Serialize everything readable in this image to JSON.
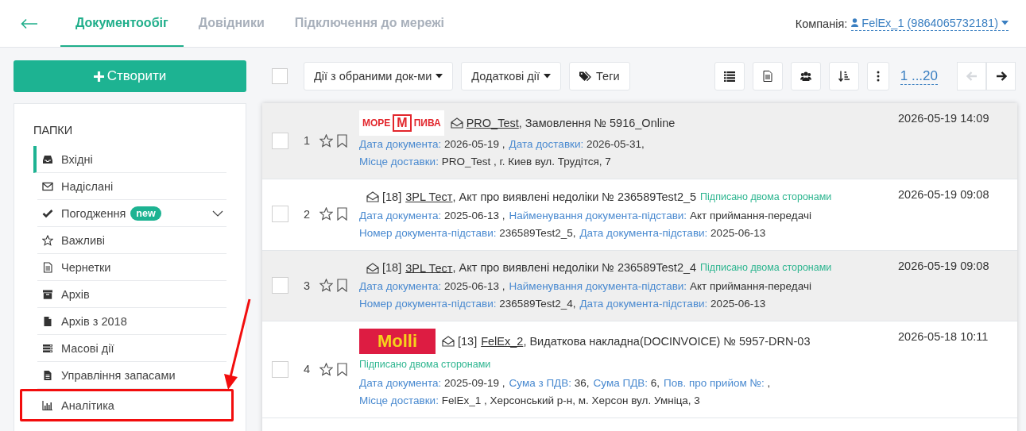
{
  "header": {
    "tabs": [
      {
        "label": "Документообіг",
        "selected": true
      },
      {
        "label": "Довідники",
        "selected": false
      },
      {
        "label": "Підключення до мережі",
        "selected": false
      }
    ],
    "company_label": "Компанія:",
    "company": "FelEx_1 (9864065732181)"
  },
  "create_button": "Створити",
  "sidebar": {
    "title": "ПАПКИ",
    "items": [
      {
        "label": "Вхідні",
        "selected": true,
        "highlighted": false
      },
      {
        "label": "Надіслані",
        "selected": false,
        "highlighted": false
      },
      {
        "label": "Погодження",
        "badge": "new",
        "expanded": false,
        "selected": false,
        "highlighted": false
      },
      {
        "label": "Важливі",
        "selected": false,
        "highlighted": false
      },
      {
        "label": "Чернетки",
        "selected": false,
        "highlighted": false
      },
      {
        "label": "Архів",
        "selected": false,
        "highlighted": false
      },
      {
        "label": "Архів з 2018",
        "selected": false,
        "highlighted": false
      },
      {
        "label": "Масові дії",
        "selected": false,
        "highlighted": false
      },
      {
        "label": "Управління запасами",
        "selected": false,
        "highlighted": false
      },
      {
        "label": "Аналітика",
        "selected": false,
        "highlighted": true
      }
    ]
  },
  "toolbar": {
    "select_all_checked": false,
    "menus": [
      "Дії з обраними док-ми",
      "Додаткові дії",
      "Теги"
    ],
    "pagination": "1 ...20",
    "prev_disabled": true,
    "next_disabled": false
  },
  "documents": [
    {
      "number": "1",
      "starred": false,
      "bookmarked": false,
      "checked": false,
      "logo": {
        "kind": "more-pyva",
        "texts": [
          "МОРЕ",
          "М",
          "ПИВА"
        ]
      },
      "sender": "PRO_Test",
      "subject": ", Замовлення № 5916_Online",
      "date": "2026-05-19 14:09",
      "details": [
        [
          {
            "label": "Дата документа:",
            "value": "2026-05-19 ,"
          },
          {
            "label": "Дата доставки:",
            "value": "2026-05-31,"
          }
        ],
        [
          {
            "label": "Місце доставки:",
            "value": "PRO_Test , г. Киев вул. Трудітся, 7"
          }
        ]
      ]
    },
    {
      "number": "2",
      "starred": false,
      "bookmarked": false,
      "checked": false,
      "counter": "[18]",
      "sender": "3PL Тест",
      "subject": ", Акт про виявлені недоліки № 236589Test2_5",
      "status": "Підписано двома сторонами",
      "date": "2026-05-19 09:08",
      "details": [
        [
          {
            "label": "Дата документа:",
            "value": "2025-06-13 ,"
          },
          {
            "label": "Найменування документа-підстави:",
            "value": "Акт приймання-передачі"
          }
        ],
        [
          {
            "label": "Номер документа-підстави:",
            "value": "236589Test2_5,"
          },
          {
            "label": "Дата документа-підстави:",
            "value": "2025-06-13"
          }
        ]
      ]
    },
    {
      "number": "3",
      "starred": false,
      "bookmarked": false,
      "checked": false,
      "counter": "[18]",
      "sender": "3PL Тест",
      "subject": ", Акт про виявлені недоліки № 236589Test2_4",
      "status": "Підписано двома сторонами",
      "date": "2026-05-19 09:08",
      "details": [
        [
          {
            "label": "Дата документа:",
            "value": "2025-06-13 ,"
          },
          {
            "label": "Найменування документа-підстави:",
            "value": "Акт приймання-передачі"
          }
        ],
        [
          {
            "label": "Номер документа-підстави:",
            "value": "236589Test2_4,"
          },
          {
            "label": "Дата документа-підстави:",
            "value": "2025-06-13"
          }
        ]
      ]
    },
    {
      "number": "4",
      "starred": false,
      "bookmarked": false,
      "checked": false,
      "logo": {
        "kind": "molli",
        "texts": [
          "Molli"
        ]
      },
      "counter": "[13]",
      "sender": "FelEx_2",
      "subject": ", Видаткова накладна(DOCINVOICE) № 5957-DRN-03",
      "status": "Підписано двома сторонами",
      "date": "2026-05-18 10:11",
      "details": [
        [
          {
            "label": "Дата документа:",
            "value": "2025-09-19 ,"
          },
          {
            "label": "Сума з ПДВ:",
            "value": "36,"
          },
          {
            "label": "Сума ПДВ:",
            "value": "6,"
          },
          {
            "label": "Пов. про прийом №:",
            "value": ","
          }
        ],
        [
          {
            "label": "Місце доставки:",
            "value": "FelEx_1 , Херсонський р-н, м. Херсон вул. Умніца, 3"
          }
        ]
      ]
    }
  ]
}
